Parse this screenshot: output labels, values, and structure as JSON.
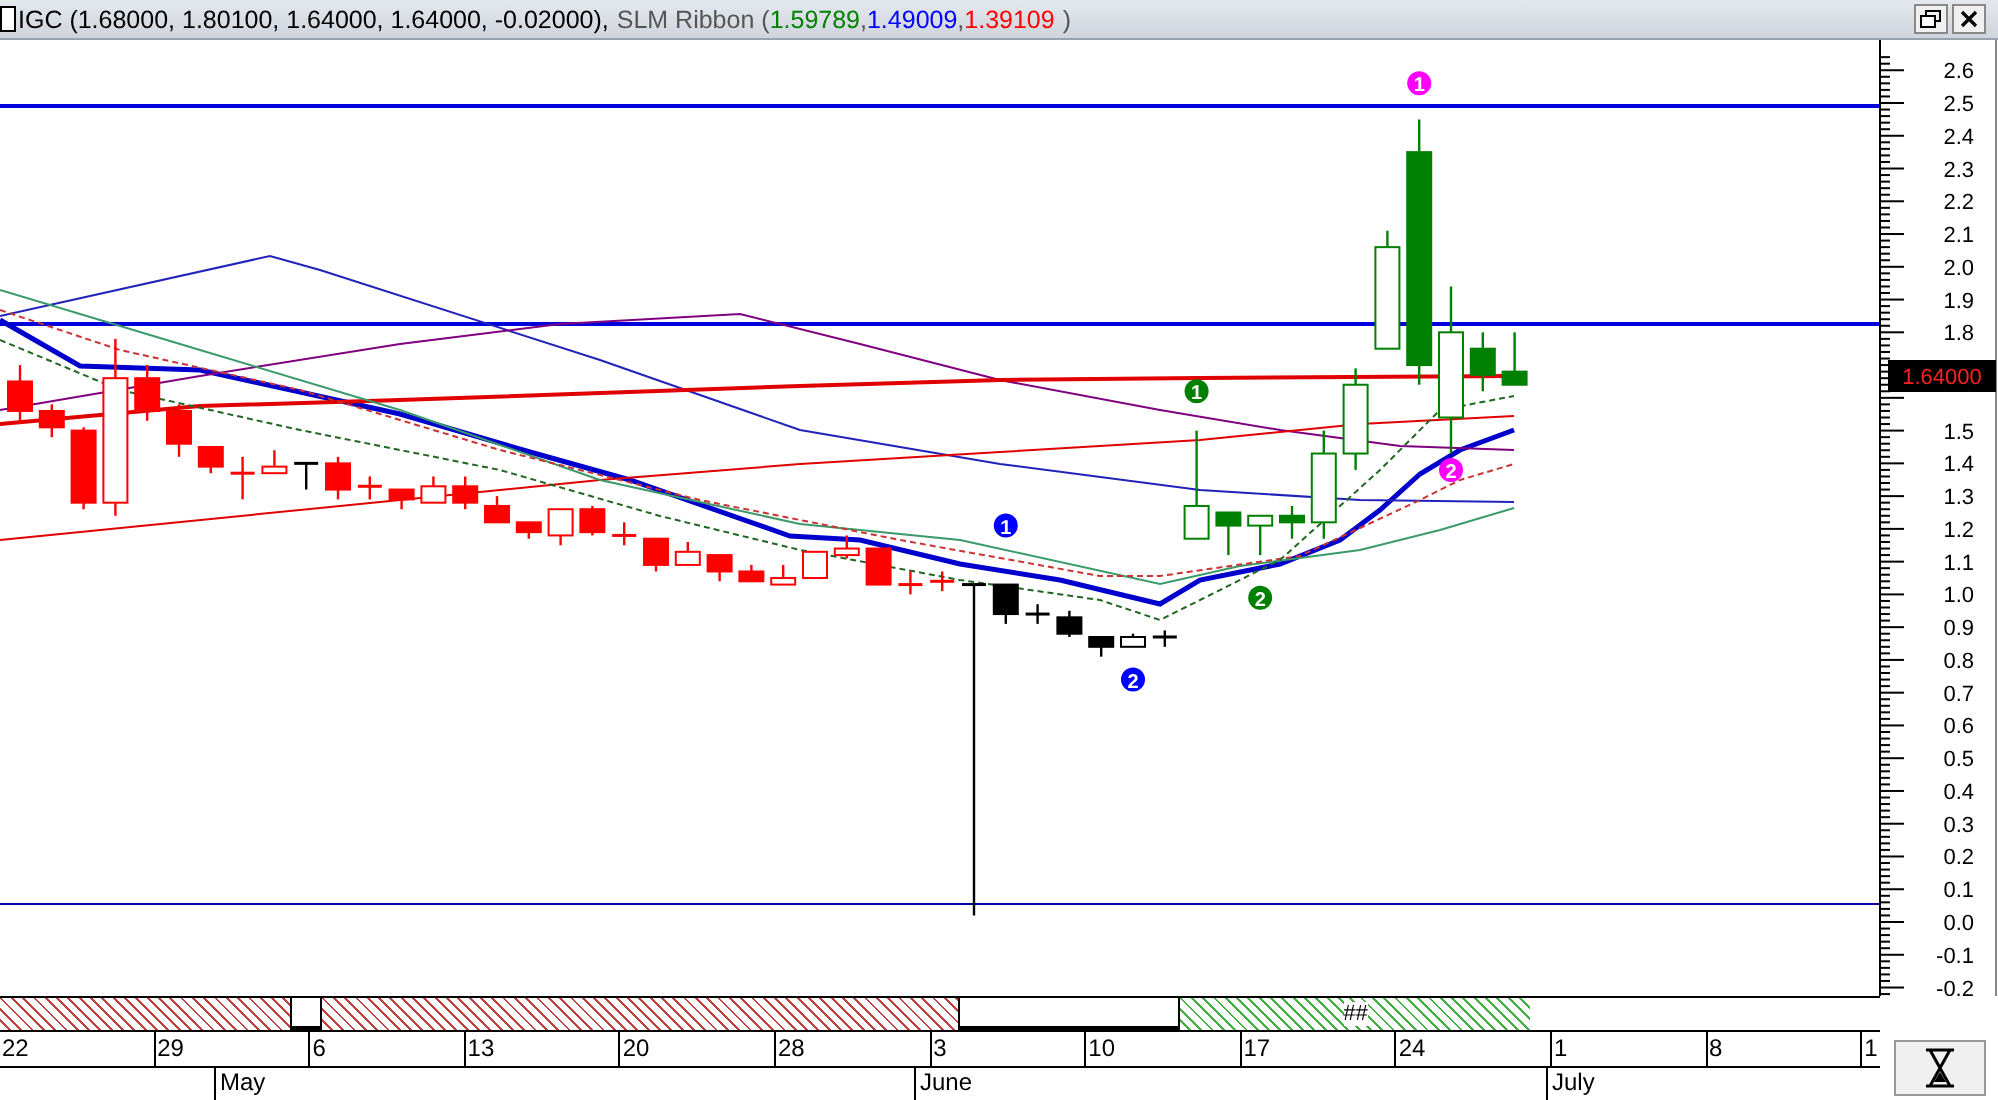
{
  "header": {
    "symbol": "IGC",
    "ohlc": "(1.68000, 1.80100, 1.64000, 1.64000, -0.02000),",
    "indicator": "SLM Ribbon (",
    "separator": ",",
    "close_paren": ")",
    "values": [
      {
        "text": "1.59789",
        "color": "#008000"
      },
      {
        "text": "1.49009",
        "color": "#0000ff"
      },
      {
        "text": "1.39109",
        "color": "#ff0000"
      }
    ]
  },
  "markers": [
    {
      "text": "1",
      "color": "#0000ff"
    },
    {
      "text": "2",
      "color": "#0000ff"
    },
    {
      "text": "1",
      "color": "#008000"
    },
    {
      "text": "2",
      "color": "#008000"
    },
    {
      "text": "1",
      "color": "#ff00ff"
    },
    {
      "text": "2",
      "color": "#ff00ff"
    }
  ],
  "y_axis_labels": [
    "2.6",
    "2.5",
    "2.4",
    "2.3",
    "2.2",
    "2.1",
    "2.0",
    "1.9",
    "1.8",
    "1.5",
    "1.4",
    "1.3",
    "1.2",
    "1.1",
    "1.0",
    "0.9",
    "0.8",
    "0.7",
    "0.6",
    "0.5",
    "0.4",
    "0.3",
    "0.2",
    "0.1",
    "0.0",
    "-0.1",
    "-0.2"
  ],
  "price_label": "1.64000",
  "strip_label": "##",
  "dates": [
    "22",
    "29",
    "6",
    "13",
    "20",
    "28",
    "3",
    "10",
    "17",
    "24",
    "1",
    "8",
    "1"
  ],
  "months": [
    "May",
    "June",
    "July"
  ]
}
